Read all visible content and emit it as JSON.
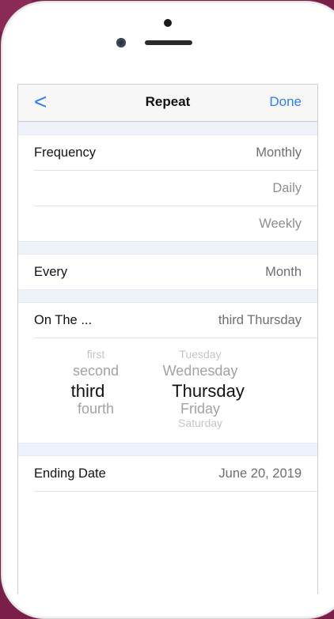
{
  "nav": {
    "back": "<",
    "title": "Repeat",
    "done": "Done"
  },
  "frequency": {
    "label": "Frequency",
    "value": "Monthly",
    "options": [
      "Daily",
      "Weekly"
    ]
  },
  "every": {
    "label": "Every",
    "value": "Month"
  },
  "on_the": {
    "label": "On The ...",
    "value": "third Thursday"
  },
  "picker": {
    "ordinal": [
      "first",
      "second",
      "third",
      "fourth"
    ],
    "ordinal_selected": "third",
    "weekday": [
      "Tuesday",
      "Wednesday",
      "Thursday",
      "Friday",
      "Saturday"
    ],
    "weekday_selected": "Thursday"
  },
  "ending": {
    "label": "Ending Date",
    "value": "June 20, 2019"
  }
}
